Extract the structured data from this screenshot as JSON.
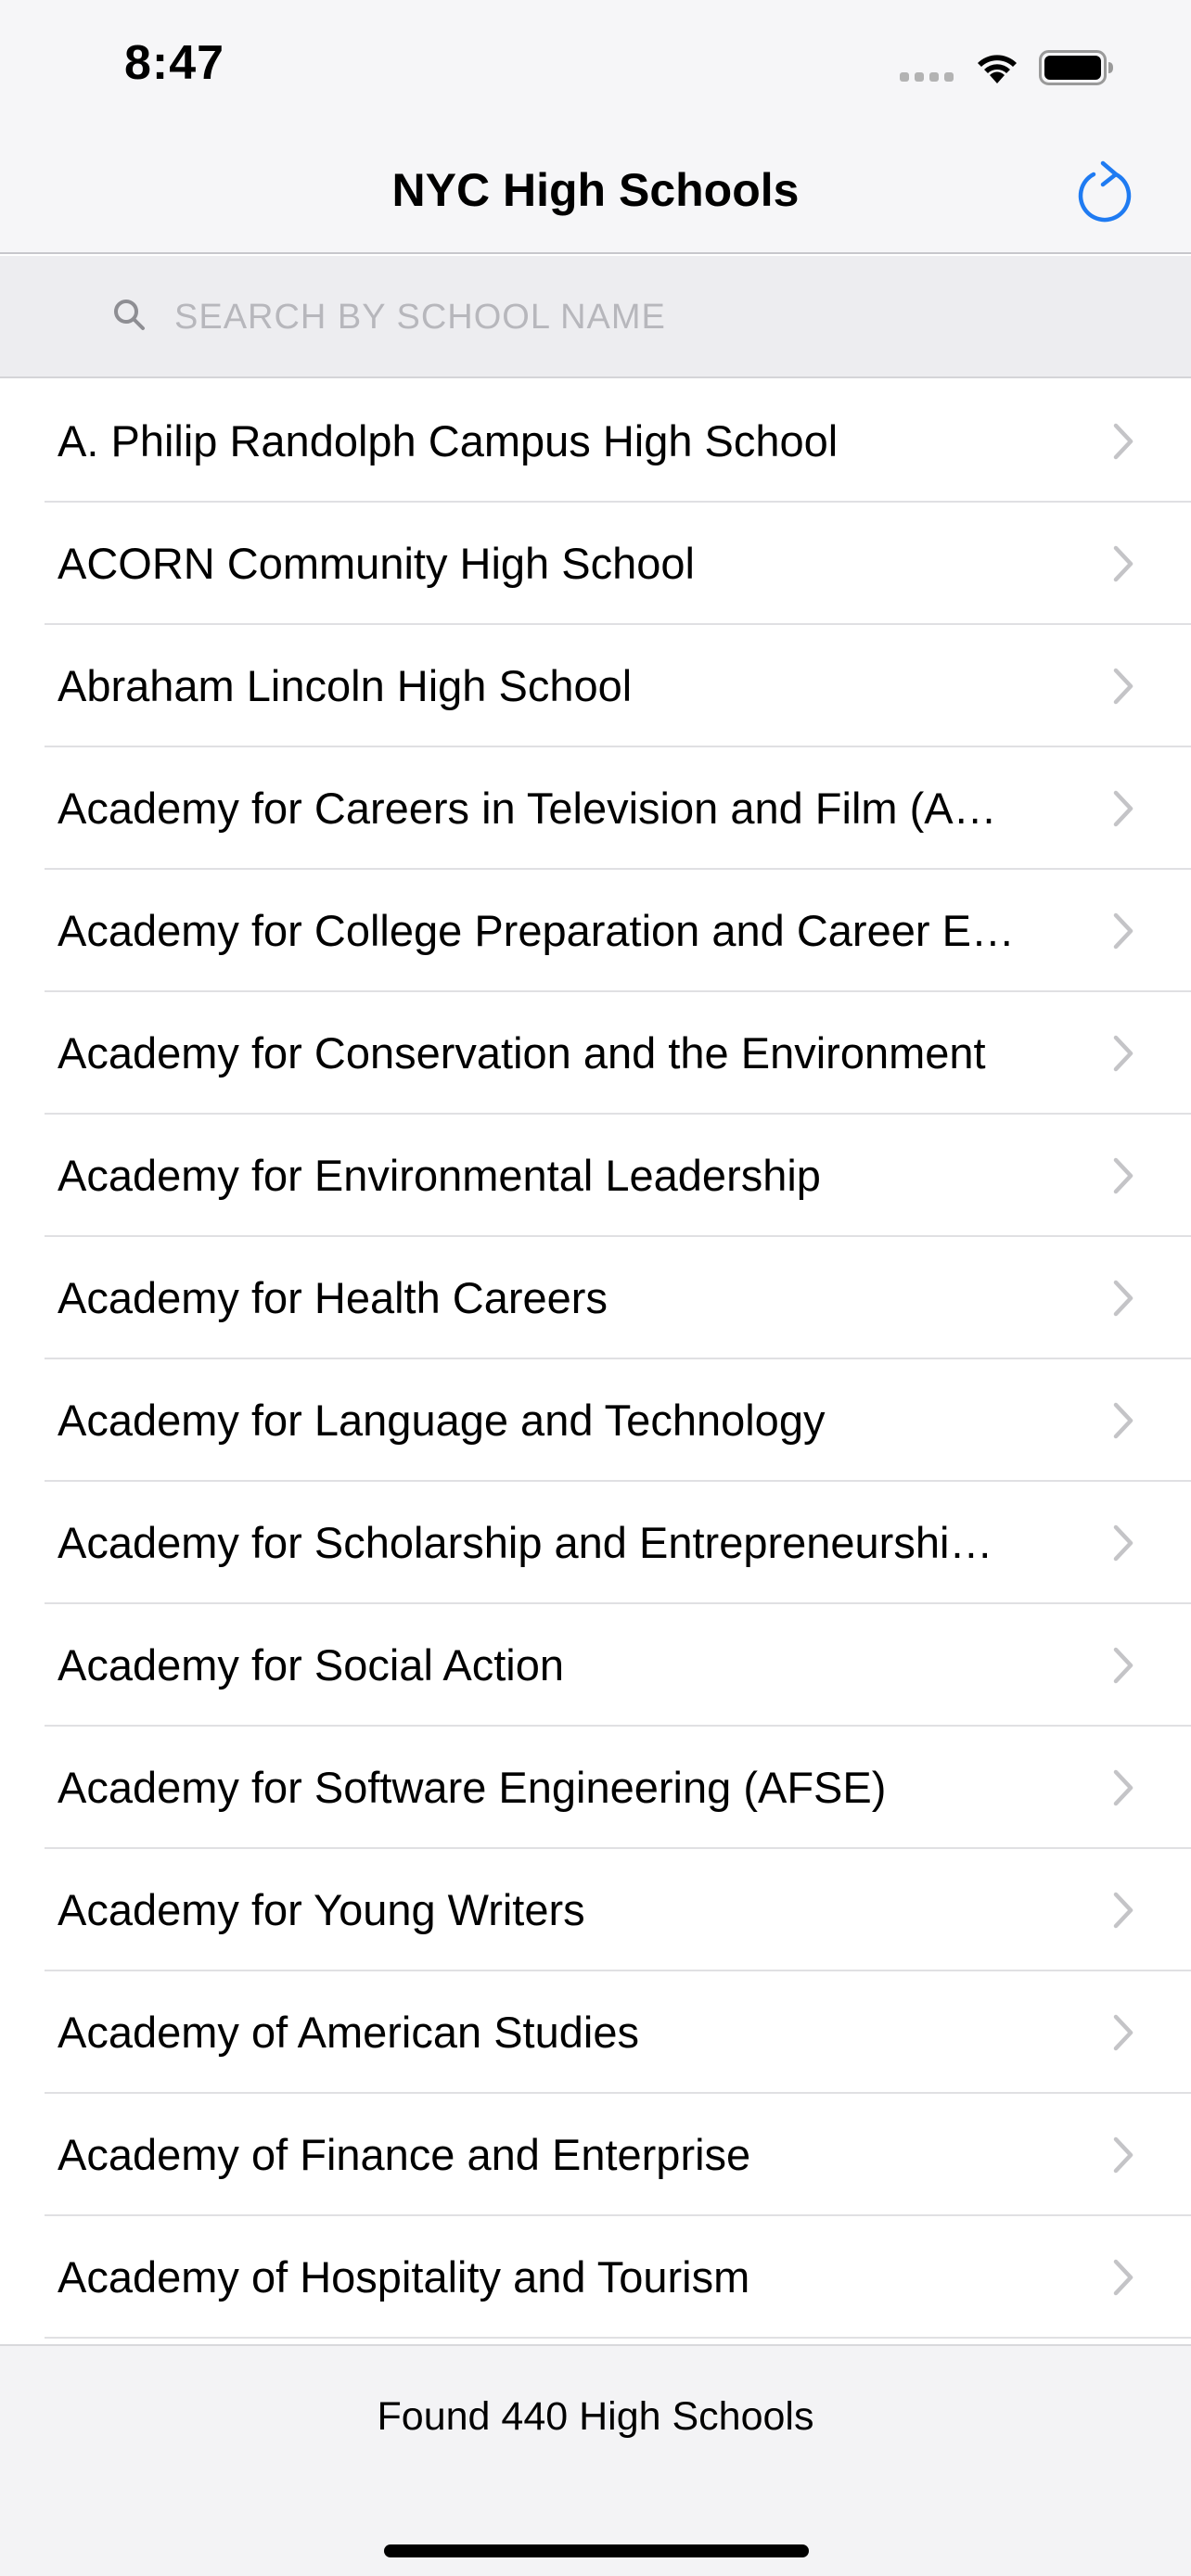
{
  "status_bar": {
    "time": "8:47"
  },
  "nav": {
    "title": "NYC High Schools",
    "refresh_icon": "refresh-icon"
  },
  "search": {
    "placeholder": "SEARCH BY SCHOOL NAME",
    "value": ""
  },
  "schools": [
    "A. Philip Randolph Campus High School",
    "ACORN Community High School",
    "Abraham Lincoln High School",
    "Academy for Careers in Television and Film (A…",
    "Academy for College Preparation and Career E…",
    "Academy for Conservation and the Environment",
    "Academy for Environmental Leadership",
    "Academy for Health Careers",
    "Academy for Language and Technology",
    "Academy for Scholarship and Entrepreneurshi…",
    "Academy for Social Action",
    "Academy for Software Engineering (AFSE)",
    "Academy for Young Writers",
    "Academy of American Studies",
    "Academy of Finance and Enterprise",
    "Academy of Hospitality and Tourism",
    ""
  ],
  "footer": {
    "count_text": "Found 440 High Schools"
  },
  "colors": {
    "accent": "#1f7bf2",
    "separator": "#e0e0e3",
    "chevron": "#c4c4c7",
    "placeholder": "#b7b7bc"
  }
}
